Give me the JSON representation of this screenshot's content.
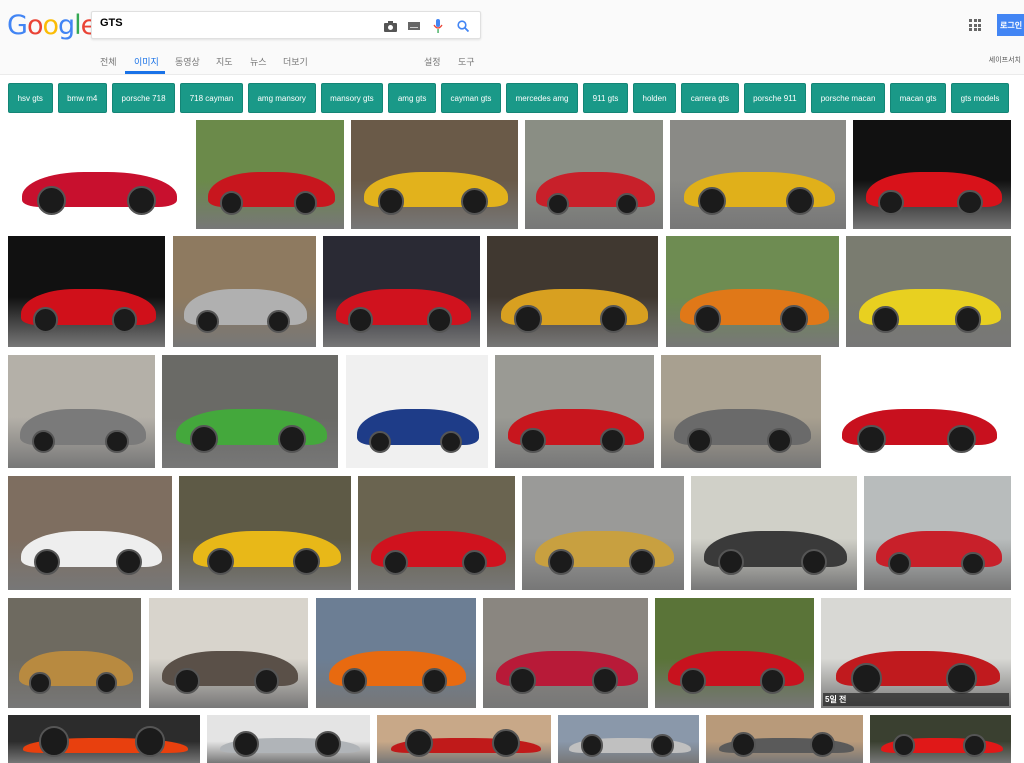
{
  "logo": "Google",
  "search": {
    "query": "GTS",
    "icons": [
      "camera-icon",
      "keyboard-icon",
      "microphone-icon",
      "search-icon"
    ]
  },
  "tabs": [
    {
      "label": "전체"
    },
    {
      "label": "이미지",
      "active": true
    },
    {
      "label": "동영상"
    },
    {
      "label": "지도"
    },
    {
      "label": "뉴스"
    },
    {
      "label": "더보기"
    },
    {
      "label": "설정"
    },
    {
      "label": "도구"
    }
  ],
  "login_label": "로그인",
  "safesearch_label": "세이프서치",
  "chips": [
    "hsv gts",
    "bmw m4",
    "porsche 718",
    "718 cayman",
    "amg mansory",
    "mansory gts",
    "amg gts",
    "cayman gts",
    "mercedes amg",
    "911 gts",
    "holden",
    "carrera gts",
    "porsche 911",
    "porsche macan",
    "macan gts",
    "gts models"
  ],
  "chip_color": "#1a9988",
  "accent": "#1a73e8",
  "images": [
    {
      "car": "#c8102e",
      "bg": "#ffffff"
    },
    {
      "car": "#c8161e",
      "bg": "#6b8a4a"
    },
    {
      "car": "#e2b21c",
      "bg": "#6a5a48"
    },
    {
      "car": "#c8202a",
      "bg": "#8a8e84"
    },
    {
      "car": "#e0b01a",
      "bg": "#8a8a86"
    },
    {
      "car": "#d8121a",
      "bg": "#111111"
    },
    {
      "car": "#d0101a",
      "bg": "#111111"
    },
    {
      "car": "#b0b0b0",
      "bg": "#8e7a60"
    },
    {
      "car": "#d0121e",
      "bg": "#2a2a34"
    },
    {
      "car": "#d8a020",
      "bg": "#403830"
    },
    {
      "car": "#e07818",
      "bg": "#6e8c52"
    },
    {
      "car": "#e8d020",
      "bg": "#7a7c70"
    },
    {
      "car": "#7a7a7a",
      "bg": "#b4b0a8"
    },
    {
      "car": "#44a83c",
      "bg": "#6a6a66"
    },
    {
      "car": "#1e3c88",
      "bg": "#f0f0f0"
    },
    {
      "car": "#c8161e",
      "bg": "#9a9a94"
    },
    {
      "car": "#6a6a6a",
      "bg": "#a8a090"
    },
    {
      "car": "#c8101e",
      "bg": "#ffffff"
    },
    {
      "car": "#eeeeee",
      "bg": "#7e6e60"
    },
    {
      "car": "#e8b818",
      "bg": "#5e5a46"
    },
    {
      "car": "#d0121e",
      "bg": "#6a6450"
    },
    {
      "car": "#c8a040",
      "bg": "#9a9a98"
    },
    {
      "car": "#3a3a3a",
      "bg": "#d0d0c8"
    },
    {
      "car": "#c8202a",
      "bg": "#b8bcbc"
    },
    {
      "car": "#b88a40",
      "bg": "#6e6a60"
    },
    {
      "car": "#5a5048",
      "bg": "#d8d4cc"
    },
    {
      "car": "#e86a10",
      "bg": "#6c7e94"
    },
    {
      "car": "#b81a38",
      "bg": "#8a8680"
    },
    {
      "car": "#c8121e",
      "bg": "#5a7438"
    },
    {
      "car": "#c01a1e",
      "bg": "#d8d8d4",
      "ago": "5일 전"
    },
    {
      "car": "#e8400e",
      "bg": "#2c2c2c"
    },
    {
      "car": "#b0b4b8",
      "bg": "#e4e4e4"
    },
    {
      "car": "#c01a1a",
      "bg": "#c8a888"
    },
    {
      "car": "#c0c0c0",
      "bg": "#8a98aa"
    },
    {
      "car": "#5a5a5a",
      "bg": "#b89a7a"
    },
    {
      "car": "#e01818",
      "bg": "#3a4030"
    }
  ]
}
